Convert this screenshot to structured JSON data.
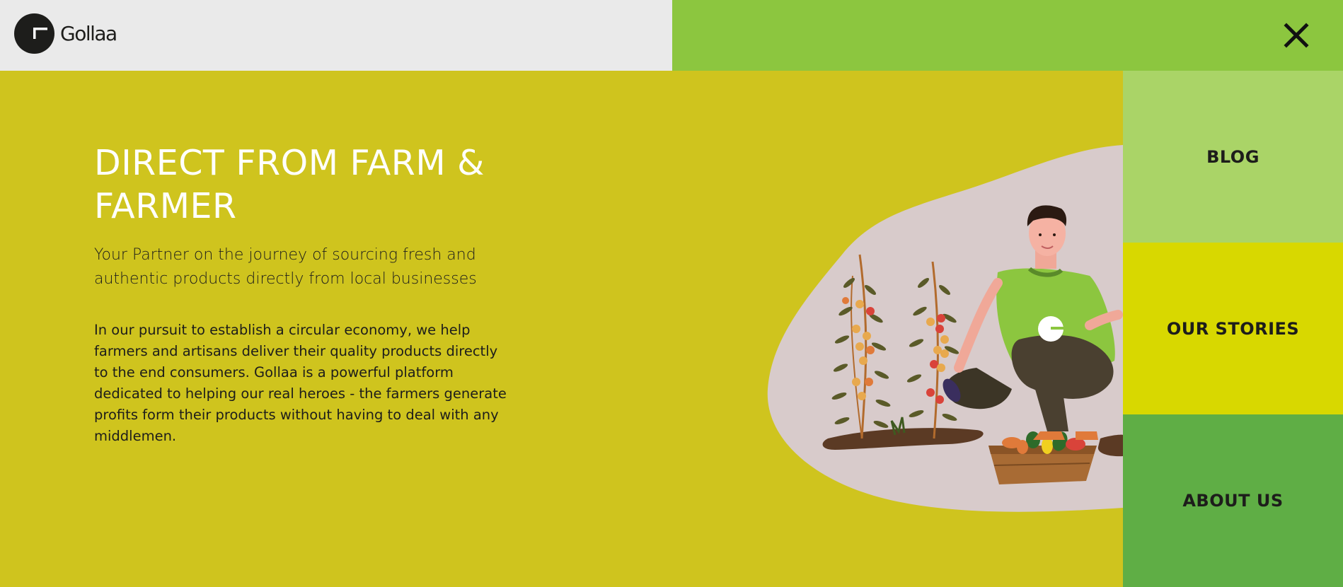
{
  "header": {
    "logo_text": "Gollaa",
    "close_icon": "close-icon"
  },
  "hero": {
    "title": "DIRECT FROM FARM & FARMER",
    "subtitle": "Your Partner on the journey of sourcing fresh and authentic products directly from local businesses",
    "body": "In our pursuit to establish a circular economy, we help farmers and artisans deliver their quality products directly to the end consumers. Gollaa is a powerful platform dedicated to helping our real heroes - the farmers generate profits form their products without having to deal with any middlemen."
  },
  "nav": {
    "items": [
      {
        "label": "BLOG"
      },
      {
        "label": "OUR STORIES"
      },
      {
        "label": "ABOUT US"
      }
    ]
  },
  "colors": {
    "page_bg": "#cfc41e",
    "topbar_left": "#eaeaea",
    "topbar_right": "#8cc63f",
    "nav_blog": "#aad467",
    "nav_stories": "#d8d800",
    "nav_about": "#5fae45"
  }
}
